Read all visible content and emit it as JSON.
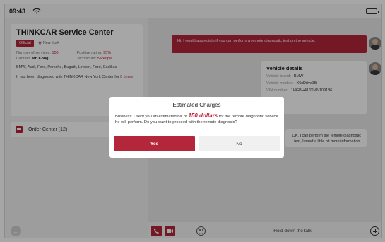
{
  "statusbar": {
    "time": "09:43"
  },
  "service": {
    "name": "THINKCAR Service Center",
    "tag": "Official",
    "location": "New York",
    "services_label": "Number of services:",
    "services_value": "100",
    "rating_label": "Positive rating:",
    "rating_value": "95%",
    "contact_label": "Contact:",
    "contact_value": "Mr. Kong",
    "technician_label": "Technician:",
    "technician_value": "5 People",
    "brands": "BMW, Audi, Ford, Porsche, Bugatti, Lincoln, Ford, Cadillac",
    "diagnosed_prefix": "It has been diagnosed with THINKCAR New York Center for",
    "diagnosed_count": "8 times"
  },
  "order_center": {
    "label": "Order Center (12)"
  },
  "chat": {
    "request_message": "Hi, I would appreciate if you can perform a remote diagnostic test on the vehicle.",
    "vehicle_title": "Vehicle details",
    "vehicle_brand_label": "Vehicle brand:",
    "vehicle_brand_value": "BMW",
    "vehicle_model_label": "Vehicle models:",
    "vehicle_model_value": "X6xDrive35i",
    "vin_label": "VIN number:",
    "vin_value": "1HGBH41JXMN109186",
    "reply_message": "OK, I can perform the remote diagnostic test, I need a little bit more information."
  },
  "bottombar": {
    "hold_label": "Hold down the talk"
  },
  "dialog": {
    "title": "Estimated Charges",
    "body_prefix": "Business 1 sent you an estimated bill of",
    "amount": "150 dollars",
    "body_suffix": "for the remote diagnostic service he will perform. Do you want to proceed with the remote diagnosis?",
    "yes_label": "Yes",
    "no_label": "No"
  },
  "colors": {
    "accent": "#b4263a"
  }
}
